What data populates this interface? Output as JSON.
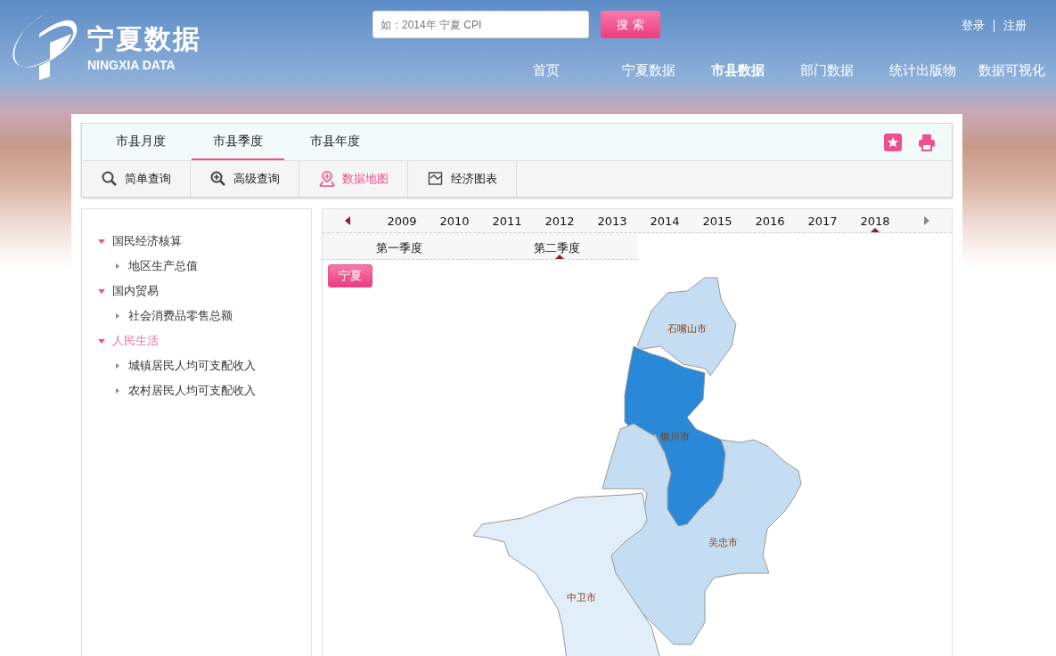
{
  "header": {
    "logo_title": "宁夏数据",
    "logo_subtitle": "NINGXIA DATA",
    "search": {
      "placeholder": "如：2014年 宁夏 CPI"
    },
    "search_button": "搜 索",
    "login": "登录",
    "register": "注册",
    "nav": [
      {
        "label": "首页",
        "selected": false
      },
      {
        "label": "宁夏数据",
        "selected": false
      },
      {
        "label": "市县数据",
        "selected": true
      },
      {
        "label": "部门数据",
        "selected": false
      },
      {
        "label": "统计出版物",
        "selected": false
      },
      {
        "label": "数据可视化",
        "selected": false
      }
    ]
  },
  "tabs": [
    {
      "label": "市县月度",
      "selected": false
    },
    {
      "label": "市县季度",
      "selected": true
    },
    {
      "label": "市县年度",
      "selected": false
    }
  ],
  "tools": [
    {
      "label": "简单查询",
      "kind": "search",
      "selected": false
    },
    {
      "label": "高级查询",
      "kind": "zoom",
      "selected": false
    },
    {
      "label": "数据地图",
      "kind": "map",
      "selected": true
    },
    {
      "label": "经济图表",
      "kind": "chart",
      "selected": false
    }
  ],
  "sidebar": {
    "items": [
      {
        "label": "国民经济核算",
        "expanded": true,
        "selected": false,
        "children": [
          {
            "label": "地区生产总值"
          }
        ]
      },
      {
        "label": "国内贸易",
        "expanded": true,
        "selected": false,
        "children": [
          {
            "label": "社会消费品零售总额"
          }
        ]
      },
      {
        "label": "人民生活",
        "expanded": true,
        "selected": true,
        "children": [
          {
            "label": "城镇居民人均可支配收入"
          },
          {
            "label": "农村居民人均可支配收入"
          }
        ]
      }
    ]
  },
  "timeline": {
    "years": [
      {
        "label": "2009",
        "selected": false
      },
      {
        "label": "2010",
        "selected": false
      },
      {
        "label": "2011",
        "selected": false
      },
      {
        "label": "2012",
        "selected": false
      },
      {
        "label": "2013",
        "selected": false
      },
      {
        "label": "2014",
        "selected": false
      },
      {
        "label": "2015",
        "selected": false
      },
      {
        "label": "2016",
        "selected": false
      },
      {
        "label": "2017",
        "selected": false
      },
      {
        "label": "2018",
        "selected": true
      }
    ],
    "quarters": [
      {
        "label": "第一季度",
        "selected": false
      },
      {
        "label": "第二季度",
        "selected": true
      }
    ]
  },
  "map": {
    "region_button": "宁夏",
    "regions": [
      {
        "label": "石嘴山市",
        "color": "#c5ddf3"
      },
      {
        "label": "银川市",
        "color": "#2a88d8"
      },
      {
        "label": "吴忠市",
        "color": "#c5ddf3"
      },
      {
        "label": "中卫市",
        "color": "#e1edf8"
      }
    ]
  }
}
